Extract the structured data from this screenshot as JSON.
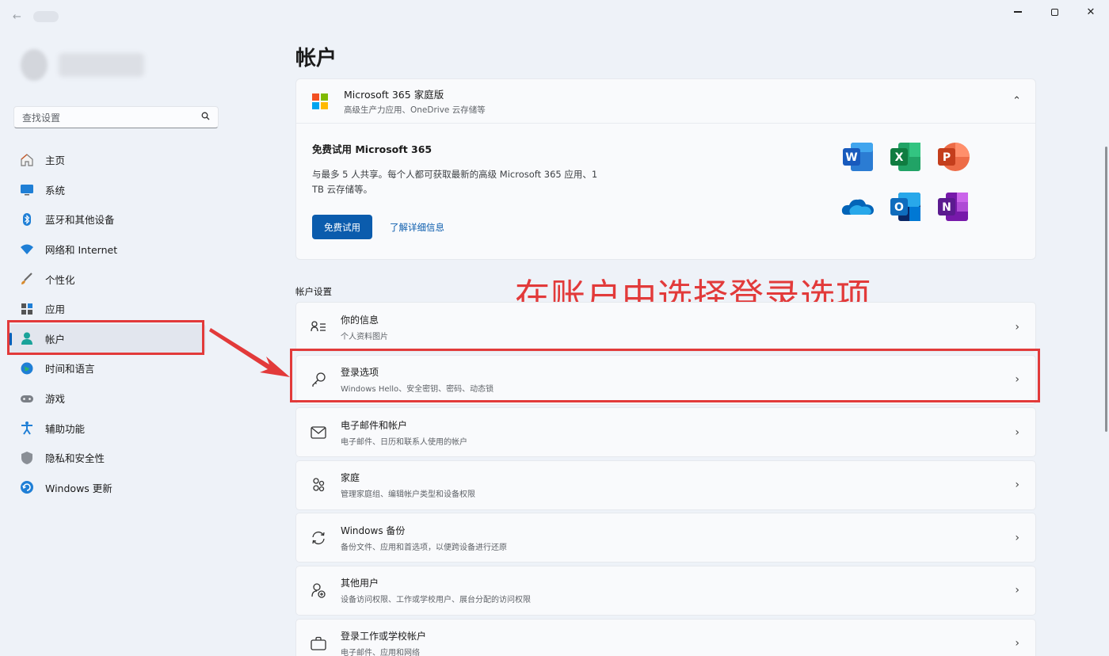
{
  "window": {
    "minimize_icon": "minimize-icon",
    "restore_icon": "restore-icon",
    "close_label": "✕"
  },
  "search": {
    "placeholder": "查找设置"
  },
  "sidebar": {
    "items": [
      {
        "label": "主页",
        "icon": "home-icon"
      },
      {
        "label": "系统",
        "icon": "system-icon"
      },
      {
        "label": "蓝牙和其他设备",
        "icon": "bluetooth-icon"
      },
      {
        "label": "网络和 Internet",
        "icon": "wifi-icon"
      },
      {
        "label": "个性化",
        "icon": "brush-icon"
      },
      {
        "label": "应用",
        "icon": "apps-icon"
      },
      {
        "label": "帐户",
        "icon": "account-icon",
        "active": true
      },
      {
        "label": "时间和语言",
        "icon": "globe-icon"
      },
      {
        "label": "游戏",
        "icon": "gamepad-icon"
      },
      {
        "label": "辅助功能",
        "icon": "accessibility-icon"
      },
      {
        "label": "隐私和安全性",
        "icon": "shield-icon"
      },
      {
        "label": "Windows 更新",
        "icon": "update-icon"
      }
    ]
  },
  "main": {
    "title": "帐户",
    "m365": {
      "title": "Microsoft 365 家庭版",
      "subtitle": "高级生产力应用、OneDrive 云存储等",
      "promo_title": "免费试用 Microsoft 365",
      "promo_desc": "与最多 5 人共享。每个人都可获取最新的高级 Microsoft 365 应用、1 TB 云存储等。",
      "try_button": "免费试用",
      "learn_more": "了解详细信息",
      "apps": [
        "Word",
        "Excel",
        "PowerPoint",
        "OneDrive",
        "Outlook",
        "OneNote"
      ]
    },
    "section_label": "帐户设置",
    "annotation": "在账户中选择登录选项",
    "rows": [
      {
        "title": "你的信息",
        "subtitle": "个人资料图片",
        "icon": "person-info-icon"
      },
      {
        "title": "登录选项",
        "subtitle": "Windows Hello、安全密钥、密码、动态锁",
        "icon": "key-icon"
      },
      {
        "title": "电子邮件和帐户",
        "subtitle": "电子邮件、日历和联系人使用的帐户",
        "icon": "mail-icon"
      },
      {
        "title": "家庭",
        "subtitle": "管理家庭组、编辑帐户类型和设备权限",
        "icon": "family-icon"
      },
      {
        "title": "Windows 备份",
        "subtitle": "备份文件、应用和首选项，以便跨设备进行还原",
        "icon": "sync-icon"
      },
      {
        "title": "其他用户",
        "subtitle": "设备访问权限、工作或学校用户、展台分配的访问权限",
        "icon": "add-user-icon"
      },
      {
        "title": "登录工作或学校帐户",
        "subtitle": "电子邮件、应用和网络",
        "icon": "briefcase-icon"
      }
    ]
  },
  "colors": {
    "accent": "#0b5cad",
    "highlight": "#e23a3a"
  }
}
